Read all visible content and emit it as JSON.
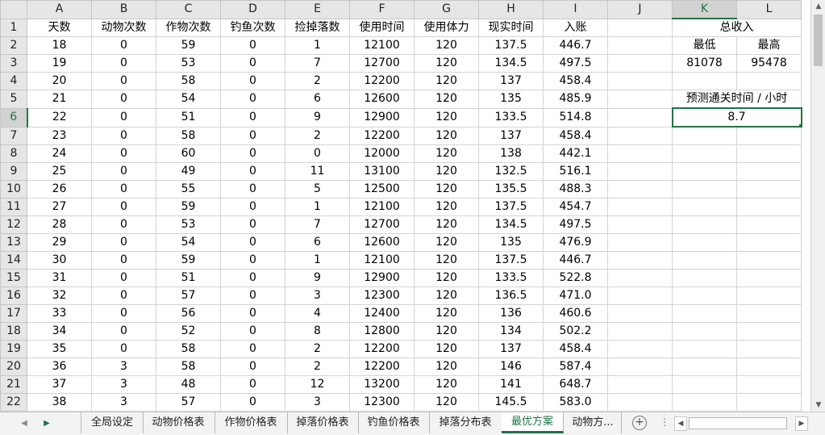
{
  "columns": [
    "A",
    "B",
    "C",
    "D",
    "E",
    "F",
    "G",
    "H",
    "I",
    "J",
    "K",
    "L"
  ],
  "selected_column": "K",
  "selected_row": 6,
  "headers": [
    "天数",
    "动物次数",
    "作物次数",
    "钓鱼次数",
    "捡掉落数",
    "使用时间",
    "使用体力",
    "现实时间",
    "入账"
  ],
  "rows": [
    [
      "18",
      "0",
      "59",
      "0",
      "1",
      "12100",
      "120",
      "137.5",
      "446.7"
    ],
    [
      "19",
      "0",
      "53",
      "0",
      "7",
      "12700",
      "120",
      "134.5",
      "497.5"
    ],
    [
      "20",
      "0",
      "58",
      "0",
      "2",
      "12200",
      "120",
      "137",
      "458.4"
    ],
    [
      "21",
      "0",
      "54",
      "0",
      "6",
      "12600",
      "120",
      "135",
      "485.9"
    ],
    [
      "22",
      "0",
      "51",
      "0",
      "9",
      "12900",
      "120",
      "133.5",
      "514.8"
    ],
    [
      "23",
      "0",
      "58",
      "0",
      "2",
      "12200",
      "120",
      "137",
      "458.4"
    ],
    [
      "24",
      "0",
      "60",
      "0",
      "0",
      "12000",
      "120",
      "138",
      "442.1"
    ],
    [
      "25",
      "0",
      "49",
      "0",
      "11",
      "13100",
      "120",
      "132.5",
      "516.1"
    ],
    [
      "26",
      "0",
      "55",
      "0",
      "5",
      "12500",
      "120",
      "135.5",
      "488.3"
    ],
    [
      "27",
      "0",
      "59",
      "0",
      "1",
      "12100",
      "120",
      "137.5",
      "454.7"
    ],
    [
      "28",
      "0",
      "53",
      "0",
      "7",
      "12700",
      "120",
      "134.5",
      "497.5"
    ],
    [
      "29",
      "0",
      "54",
      "0",
      "6",
      "12600",
      "120",
      "135",
      "476.9"
    ],
    [
      "30",
      "0",
      "59",
      "0",
      "1",
      "12100",
      "120",
      "137.5",
      "446.7"
    ],
    [
      "31",
      "0",
      "51",
      "0",
      "9",
      "12900",
      "120",
      "133.5",
      "522.8"
    ],
    [
      "32",
      "0",
      "57",
      "0",
      "3",
      "12300",
      "120",
      "136.5",
      "471.0"
    ],
    [
      "33",
      "0",
      "56",
      "0",
      "4",
      "12400",
      "120",
      "136",
      "460.6"
    ],
    [
      "34",
      "0",
      "52",
      "0",
      "8",
      "12800",
      "120",
      "134",
      "502.2"
    ],
    [
      "35",
      "0",
      "58",
      "0",
      "2",
      "12200",
      "120",
      "137",
      "458.4"
    ],
    [
      "36",
      "3",
      "58",
      "0",
      "2",
      "12200",
      "120",
      "146",
      "587.4"
    ],
    [
      "37",
      "3",
      "48",
      "0",
      "12",
      "13200",
      "120",
      "141",
      "648.7"
    ],
    [
      "38",
      "3",
      "57",
      "0",
      "3",
      "12300",
      "120",
      "145.5",
      "583.0"
    ]
  ],
  "summary": {
    "total_income_label": "总收入",
    "min_label": "最低",
    "max_label": "最高",
    "min_value": "81078",
    "max_value": "95478",
    "forecast_label": "预测通关时间 / 小时",
    "forecast_value": "8.7"
  },
  "sheet_tabs": [
    "全局设定",
    "动物价格表",
    "作物价格表",
    "掉落价格表",
    "钓鱼价格表",
    "掉落分布表",
    "最优方案",
    "动物方..."
  ],
  "active_tab": "最优方案",
  "accent_color": "#217346"
}
